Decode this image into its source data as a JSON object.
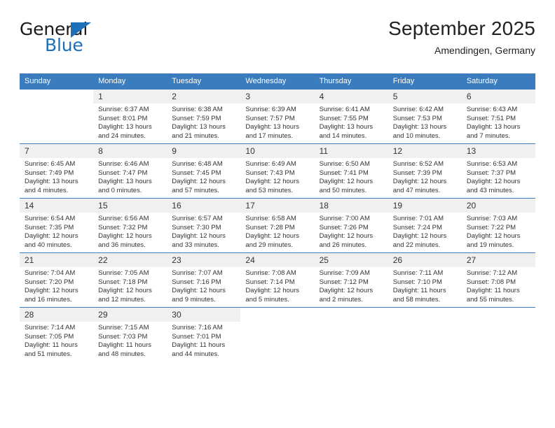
{
  "brand": {
    "line1": "General",
    "line2": "Blue",
    "triangle_color": "#1d70b8",
    "text_color": "#1a1a1a"
  },
  "header": {
    "title": "September 2025",
    "subtitle": "Amendingen, Germany"
  },
  "colors": {
    "header_blue": "#3a7cbe",
    "daynum_band": "#f0f0f0",
    "text": "#333333"
  },
  "calendar": {
    "weekdays": [
      "Sunday",
      "Monday",
      "Tuesday",
      "Wednesday",
      "Thursday",
      "Friday",
      "Saturday"
    ],
    "weeks": [
      [
        {
          "day": "",
          "blank": true,
          "sunrise": "",
          "sunset": "",
          "daylight": ""
        },
        {
          "day": "1",
          "sunrise": "Sunrise: 6:37 AM",
          "sunset": "Sunset: 8:01 PM",
          "daylight": "Daylight: 13 hours and 24 minutes."
        },
        {
          "day": "2",
          "sunrise": "Sunrise: 6:38 AM",
          "sunset": "Sunset: 7:59 PM",
          "daylight": "Daylight: 13 hours and 21 minutes."
        },
        {
          "day": "3",
          "sunrise": "Sunrise: 6:39 AM",
          "sunset": "Sunset: 7:57 PM",
          "daylight": "Daylight: 13 hours and 17 minutes."
        },
        {
          "day": "4",
          "sunrise": "Sunrise: 6:41 AM",
          "sunset": "Sunset: 7:55 PM",
          "daylight": "Daylight: 13 hours and 14 minutes."
        },
        {
          "day": "5",
          "sunrise": "Sunrise: 6:42 AM",
          "sunset": "Sunset: 7:53 PM",
          "daylight": "Daylight: 13 hours and 10 minutes."
        },
        {
          "day": "6",
          "sunrise": "Sunrise: 6:43 AM",
          "sunset": "Sunset: 7:51 PM",
          "daylight": "Daylight: 13 hours and 7 minutes."
        }
      ],
      [
        {
          "day": "7",
          "sunrise": "Sunrise: 6:45 AM",
          "sunset": "Sunset: 7:49 PM",
          "daylight": "Daylight: 13 hours and 4 minutes."
        },
        {
          "day": "8",
          "sunrise": "Sunrise: 6:46 AM",
          "sunset": "Sunset: 7:47 PM",
          "daylight": "Daylight: 13 hours and 0 minutes."
        },
        {
          "day": "9",
          "sunrise": "Sunrise: 6:48 AM",
          "sunset": "Sunset: 7:45 PM",
          "daylight": "Daylight: 12 hours and 57 minutes."
        },
        {
          "day": "10",
          "sunrise": "Sunrise: 6:49 AM",
          "sunset": "Sunset: 7:43 PM",
          "daylight": "Daylight: 12 hours and 53 minutes."
        },
        {
          "day": "11",
          "sunrise": "Sunrise: 6:50 AM",
          "sunset": "Sunset: 7:41 PM",
          "daylight": "Daylight: 12 hours and 50 minutes."
        },
        {
          "day": "12",
          "sunrise": "Sunrise: 6:52 AM",
          "sunset": "Sunset: 7:39 PM",
          "daylight": "Daylight: 12 hours and 47 minutes."
        },
        {
          "day": "13",
          "sunrise": "Sunrise: 6:53 AM",
          "sunset": "Sunset: 7:37 PM",
          "daylight": "Daylight: 12 hours and 43 minutes."
        }
      ],
      [
        {
          "day": "14",
          "sunrise": "Sunrise: 6:54 AM",
          "sunset": "Sunset: 7:35 PM",
          "daylight": "Daylight: 12 hours and 40 minutes."
        },
        {
          "day": "15",
          "sunrise": "Sunrise: 6:56 AM",
          "sunset": "Sunset: 7:32 PM",
          "daylight": "Daylight: 12 hours and 36 minutes."
        },
        {
          "day": "16",
          "sunrise": "Sunrise: 6:57 AM",
          "sunset": "Sunset: 7:30 PM",
          "daylight": "Daylight: 12 hours and 33 minutes."
        },
        {
          "day": "17",
          "sunrise": "Sunrise: 6:58 AM",
          "sunset": "Sunset: 7:28 PM",
          "daylight": "Daylight: 12 hours and 29 minutes."
        },
        {
          "day": "18",
          "sunrise": "Sunrise: 7:00 AM",
          "sunset": "Sunset: 7:26 PM",
          "daylight": "Daylight: 12 hours and 26 minutes."
        },
        {
          "day": "19",
          "sunrise": "Sunrise: 7:01 AM",
          "sunset": "Sunset: 7:24 PM",
          "daylight": "Daylight: 12 hours and 22 minutes."
        },
        {
          "day": "20",
          "sunrise": "Sunrise: 7:03 AM",
          "sunset": "Sunset: 7:22 PM",
          "daylight": "Daylight: 12 hours and 19 minutes."
        }
      ],
      [
        {
          "day": "21",
          "sunrise": "Sunrise: 7:04 AM",
          "sunset": "Sunset: 7:20 PM",
          "daylight": "Daylight: 12 hours and 16 minutes."
        },
        {
          "day": "22",
          "sunrise": "Sunrise: 7:05 AM",
          "sunset": "Sunset: 7:18 PM",
          "daylight": "Daylight: 12 hours and 12 minutes."
        },
        {
          "day": "23",
          "sunrise": "Sunrise: 7:07 AM",
          "sunset": "Sunset: 7:16 PM",
          "daylight": "Daylight: 12 hours and 9 minutes."
        },
        {
          "day": "24",
          "sunrise": "Sunrise: 7:08 AM",
          "sunset": "Sunset: 7:14 PM",
          "daylight": "Daylight: 12 hours and 5 minutes."
        },
        {
          "day": "25",
          "sunrise": "Sunrise: 7:09 AM",
          "sunset": "Sunset: 7:12 PM",
          "daylight": "Daylight: 12 hours and 2 minutes."
        },
        {
          "day": "26",
          "sunrise": "Sunrise: 7:11 AM",
          "sunset": "Sunset: 7:10 PM",
          "daylight": "Daylight: 11 hours and 58 minutes."
        },
        {
          "day": "27",
          "sunrise": "Sunrise: 7:12 AM",
          "sunset": "Sunset: 7:08 PM",
          "daylight": "Daylight: 11 hours and 55 minutes."
        }
      ],
      [
        {
          "day": "28",
          "sunrise": "Sunrise: 7:14 AM",
          "sunset": "Sunset: 7:05 PM",
          "daylight": "Daylight: 11 hours and 51 minutes."
        },
        {
          "day": "29",
          "sunrise": "Sunrise: 7:15 AM",
          "sunset": "Sunset: 7:03 PM",
          "daylight": "Daylight: 11 hours and 48 minutes."
        },
        {
          "day": "30",
          "sunrise": "Sunrise: 7:16 AM",
          "sunset": "Sunset: 7:01 PM",
          "daylight": "Daylight: 11 hours and 44 minutes."
        },
        {
          "day": "",
          "blank": true,
          "sunrise": "",
          "sunset": "",
          "daylight": ""
        },
        {
          "day": "",
          "blank": true,
          "sunrise": "",
          "sunset": "",
          "daylight": ""
        },
        {
          "day": "",
          "blank": true,
          "sunrise": "",
          "sunset": "",
          "daylight": ""
        },
        {
          "day": "",
          "blank": true,
          "sunrise": "",
          "sunset": "",
          "daylight": ""
        }
      ]
    ]
  }
}
